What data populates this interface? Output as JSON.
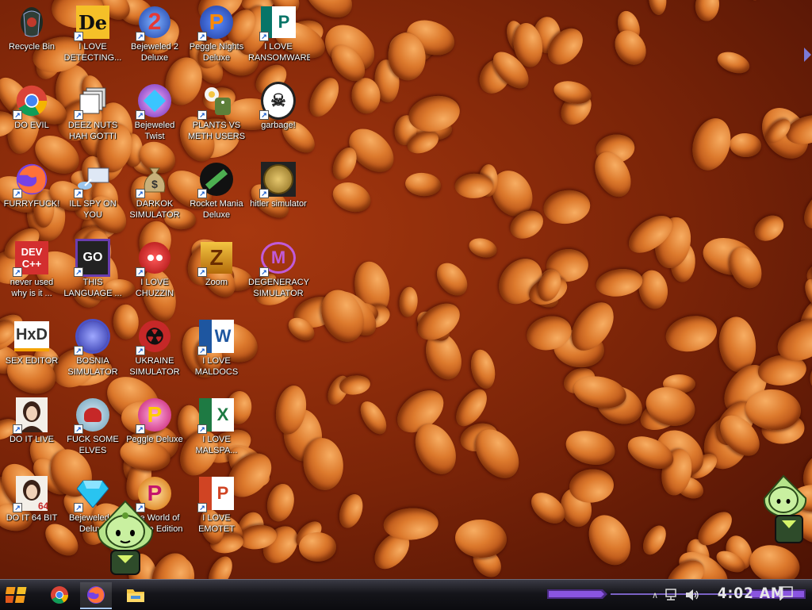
{
  "desktop": {
    "icons": [
      {
        "label": "Recycle Bin",
        "icon": "recycle-bin-icon",
        "shortcut": false
      },
      {
        "label": "I LOVE DETECTING...",
        "icon": "detect-it-easy-icon",
        "shortcut": true
      },
      {
        "label": "Bejeweled 2 Deluxe",
        "icon": "bejeweled2-icon",
        "shortcut": true
      },
      {
        "label": "Peggle Nights Deluxe",
        "icon": "peggle-nights-icon",
        "shortcut": true
      },
      {
        "label": "I LOVE RANSOMWARE",
        "icon": "publisher-icon",
        "shortcut": true
      },
      {
        "label": "DO EVIL",
        "icon": "chrome-icon",
        "shortcut": true
      },
      {
        "label": "DEEZ NUTS HAH GOTTI",
        "icon": "stacked-windows-icon",
        "shortcut": true
      },
      {
        "label": "Bejeweled Twist",
        "icon": "bejeweled-twist-icon",
        "shortcut": true
      },
      {
        "label": "PLANTS VS METH USERS",
        "icon": "plants-vs-zombies-icon",
        "shortcut": true
      },
      {
        "label": "garbage!",
        "icon": "dragon-emblem-icon",
        "shortcut": true
      },
      {
        "label": "FURRYFUCK!",
        "icon": "firefox-icon",
        "shortcut": true
      },
      {
        "label": "ILL SPY ON YOU",
        "icon": "remote-desktop-icon",
        "shortcut": true
      },
      {
        "label": "DARKOK SIMULATOR",
        "icon": "money-bag-icon",
        "shortcut": true
      },
      {
        "label": "Rocket Mania Deluxe",
        "icon": "rocket-mania-icon",
        "shortcut": true
      },
      {
        "label": "hitler simulator",
        "icon": "coin-emblem-icon",
        "shortcut": true
      },
      {
        "label": "never used why is it ...",
        "icon": "dev-cpp-icon",
        "shortcut": true
      },
      {
        "label": "THIS LANGUAGE ...",
        "icon": "go-language-icon",
        "shortcut": true
      },
      {
        "label": "I LOVE CHUZZIN",
        "icon": "chuzzle-icon",
        "shortcut": true
      },
      {
        "label": "Zoom",
        "icon": "zuma-icon",
        "shortcut": true
      },
      {
        "label": "DEGENERACY SIMULATOR",
        "icon": "mmd-icon",
        "shortcut": true
      },
      {
        "label": "SEX EDITOR",
        "icon": "hxd-icon",
        "shortcut": false
      },
      {
        "label": "BOSNIA SIMULATOR",
        "icon": "spiky-ball-icon",
        "shortcut": true
      },
      {
        "label": "UKRAINE SIMULATOR",
        "icon": "radiation-icon",
        "shortcut": true
      },
      {
        "label": "I LOVE MALDOCS",
        "icon": "word-icon",
        "shortcut": true
      },
      {
        "label": "DO IT LIVE",
        "icon": "portrait-icon",
        "shortcut": true
      },
      {
        "label": "FUCK SOME ELVES",
        "icon": "santa-icon",
        "shortcut": true
      },
      {
        "label": "Peggle Deluxe",
        "icon": "peggle-icon",
        "shortcut": true
      },
      {
        "label": "I LOVE MALSPA...",
        "icon": "excel-icon",
        "shortcut": true
      },
      {
        "label": "DO IT 64 BIT",
        "icon": "portrait-64-icon",
        "shortcut": true
      },
      {
        "label": "Bejeweled 3 Deluxe",
        "icon": "diamond-icon",
        "shortcut": true
      },
      {
        "label": "The World of Peggle Edition",
        "icon": "peggle-world-icon",
        "shortcut": true
      },
      {
        "label": "I LOVE EMOTET",
        "icon": "powerpoint-icon",
        "shortcut": true
      }
    ]
  },
  "taskbar": {
    "start_icon": "start-logo-icon",
    "pinned": [
      {
        "name": "chrome-icon",
        "active": false
      },
      {
        "name": "firefox-icon",
        "active": true
      },
      {
        "name": "file-explorer-icon",
        "active": false
      }
    ],
    "clock": "4:02 AM",
    "tray": [
      "show-hidden-icons-chevron-icon",
      "network-icon",
      "volume-icon"
    ],
    "notification_icon": "notification-icon"
  },
  "colors": {
    "taskbar_bg": "#15151a",
    "accent_purple": "#6a3db0",
    "label_text": "#ffffff",
    "bean_orange": "#dd7a2d"
  }
}
